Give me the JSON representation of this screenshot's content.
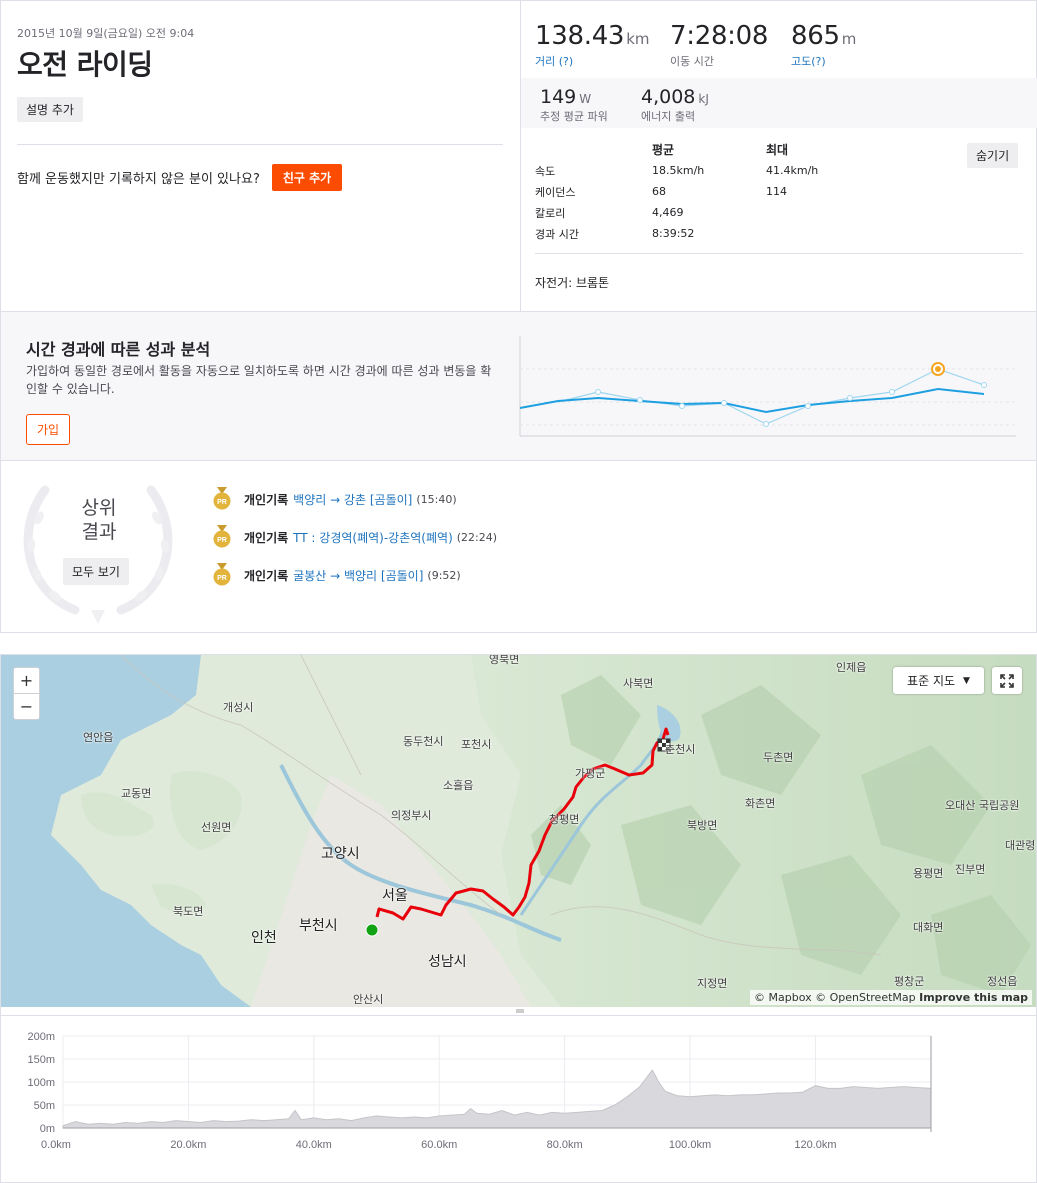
{
  "activity": {
    "date": "2015년 10월 9일(금요일) 오전 9:04",
    "title": "오전 라이딩",
    "add_description": "설명 추가",
    "friends_prompt": "함께 운동했지만 기록하지 않은 분이 있나요?",
    "add_friend": "친구 추가"
  },
  "stats": {
    "distance": {
      "value": "138.43",
      "unit": "km",
      "label": "거리 (?)"
    },
    "moving_time": {
      "value": "7:28:08",
      "label": "이동 시간"
    },
    "elevation": {
      "value": "865",
      "unit": "m",
      "label": "고도(?)"
    },
    "power": {
      "value": "149",
      "unit": "W",
      "label": "추정 평균 파워"
    },
    "energy": {
      "value": "4,008",
      "unit": "kJ",
      "label": "에너지 출력"
    }
  },
  "details_table": {
    "col_avg": "평균",
    "col_max": "최대",
    "hide": "숨기기",
    "rows": [
      {
        "label": "속도",
        "avg": "18.5km/h",
        "max": "41.4km/h"
      },
      {
        "label": "케이던스",
        "avg": "68",
        "max": "114"
      },
      {
        "label": "칼로리",
        "avg": "4,469",
        "max": ""
      },
      {
        "label": "경과 시간",
        "avg": "8:39:52",
        "max": ""
      }
    ],
    "bike": "자전거: 브롬톤"
  },
  "analysis": {
    "title": "시간 경과에 따른 성과 분석",
    "description": "가입하여 동일한 경로에서 활동을 자동으로 일치하도록 하면 시간 경과에 따른 성과 변동을 확인할 수 있습니다.",
    "join": "가입",
    "line_color": "#1e9fe0",
    "highlight_color": "#f5a623"
  },
  "top_results": {
    "title_line1": "상위",
    "title_line2": "결과",
    "view_all": "모두 보기",
    "items": [
      {
        "badge": "PR",
        "label": "개인기록",
        "segment": "백양리 → 강촌 [곰돌이]",
        "time": "(15:40)"
      },
      {
        "badge": "PR",
        "label": "개인기록",
        "segment": "TT : 강경역(폐역)-강촌역(폐역)",
        "time": "(22:24)"
      },
      {
        "badge": "PR",
        "label": "개인기록",
        "segment": "굴봉산 → 백양리 [곰돌이]",
        "time": "(9:52)"
      }
    ]
  },
  "map": {
    "zoom_in": "+",
    "zoom_out": "−",
    "style_select": "표준 지도",
    "attribution_mapbox": "© Mapbox",
    "attribution_osm": "© OpenStreetMap",
    "attribution_improve": "Improve this map",
    "route_color": "#e8000b",
    "labels": {
      "l1": "개성시",
      "l2": "연안읍",
      "l3": "교동면",
      "l4": "선원면",
      "l5": "북도면",
      "l6": "동두천시",
      "l7": "포천시",
      "l8": "소흘읍",
      "l9": "의정부시",
      "l10": "고양시",
      "l11": "서울",
      "l12": "부천시",
      "l13": "인천",
      "l14": "성남시",
      "l15": "안산시",
      "l16": "사북면",
      "l17": "춘천시",
      "l18": "가평군",
      "l19": "청평면",
      "l20": "북방면",
      "l21": "두촌면",
      "l22": "화촌면",
      "l23": "인제읍",
      "l24": "오대산 국립공원",
      "l25": "대관령",
      "l26": "진부면",
      "l27": "용평면",
      "l28": "대화면",
      "l29": "평창군",
      "l30": "정선읍",
      "l31": "지정면",
      "l32": "영북면"
    }
  },
  "elevation_chart": {
    "y_ticks": [
      "200m",
      "150m",
      "100m",
      "50m",
      "0m"
    ],
    "x_ticks": [
      "0.0km",
      "20.0km",
      "40.0km",
      "60.0km",
      "80.0km",
      "100.0km",
      "120.0km"
    ]
  },
  "chart_data": {
    "type": "area",
    "x_unit": "km",
    "y_unit": "m",
    "xlim": [
      0,
      138.43
    ],
    "ylim": [
      0,
      200
    ],
    "x": [
      0,
      2,
      4,
      6,
      8,
      10,
      12,
      14,
      16,
      18,
      20,
      22,
      24,
      26,
      28,
      30,
      32,
      34,
      36,
      37,
      38,
      40,
      42,
      44,
      46,
      48,
      50,
      52,
      54,
      56,
      58,
      60,
      62,
      64,
      65,
      66,
      68,
      70,
      72,
      74,
      76,
      78,
      80,
      82,
      84,
      86,
      88,
      90,
      92,
      93,
      94,
      95,
      96,
      98,
      100,
      102,
      104,
      106,
      108,
      110,
      112,
      114,
      116,
      118,
      120,
      122,
      124,
      126,
      128,
      130,
      132,
      134,
      136,
      138.43
    ],
    "y": [
      5,
      14,
      8,
      10,
      8,
      12,
      10,
      14,
      12,
      16,
      14,
      12,
      16,
      14,
      15,
      18,
      16,
      18,
      20,
      38,
      18,
      22,
      18,
      20,
      16,
      22,
      26,
      24,
      22,
      24,
      22,
      26,
      28,
      30,
      42,
      32,
      30,
      38,
      28,
      34,
      28,
      34,
      32,
      34,
      36,
      38,
      50,
      68,
      90,
      108,
      126,
      100,
      80,
      70,
      68,
      70,
      72,
      70,
      72,
      72,
      74,
      76,
      76,
      78,
      92,
      86,
      86,
      90,
      88,
      86,
      88,
      90,
      88,
      86
    ]
  }
}
